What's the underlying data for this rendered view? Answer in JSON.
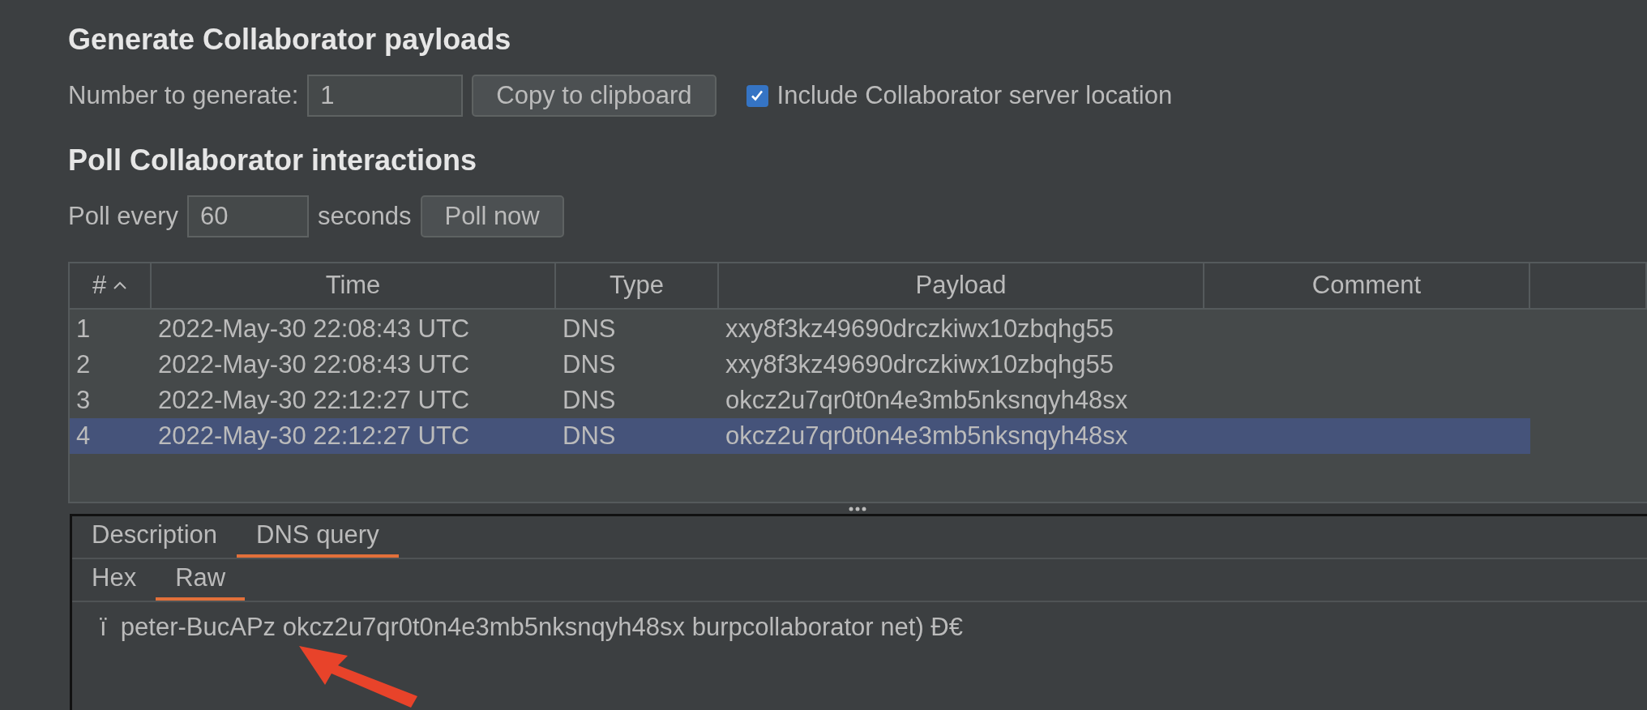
{
  "generate": {
    "heading": "Generate Collaborator payloads",
    "number_label": "Number to generate:",
    "number_value": "1",
    "copy_button": "Copy to clipboard",
    "include_location": {
      "label": "Include Collaborator server location",
      "checked": true
    }
  },
  "poll": {
    "heading": "Poll Collaborator interactions",
    "label_before": "Poll every",
    "interval_value": "60",
    "label_after": "seconds",
    "poll_button": "Poll now"
  },
  "table": {
    "columns": [
      {
        "label": "#",
        "sorted": true
      },
      {
        "label": "Time",
        "sorted": false
      },
      {
        "label": "Type",
        "sorted": false
      },
      {
        "label": "Payload",
        "sorted": false
      },
      {
        "label": "Comment",
        "sorted": false
      }
    ],
    "rows": [
      {
        "cells": [
          "1",
          "2022-May-30 22:08:43 UTC",
          "DNS",
          "xxy8f3kz49690drczkiwx10zbqhg55"
        ],
        "selected": false
      },
      {
        "cells": [
          "2",
          "2022-May-30 22:08:43 UTC",
          "DNS",
          "xxy8f3kz49690drczkiwx10zbqhg55"
        ],
        "selected": false
      },
      {
        "cells": [
          "3",
          "2022-May-30 22:12:27 UTC",
          "DNS",
          "okcz2u7qr0t0n4e3mb5nksnqyh48sx"
        ],
        "selected": false
      },
      {
        "cells": [
          "4",
          "2022-May-30 22:12:27 UTC",
          "DNS",
          "okcz2u7qr0t0n4e3mb5nksnqyh48sx"
        ],
        "selected": true
      }
    ]
  },
  "detail": {
    "tabs": [
      {
        "label": "Description",
        "selected": false
      },
      {
        "label": "DNS query",
        "selected": true
      }
    ],
    "subtabs": [
      {
        "label": "Hex",
        "selected": false
      },
      {
        "label": "Raw",
        "selected": true
      }
    ],
    "raw_text": "ï  peter-BucAPz okcz2u7qr0t0n4e3mb5nksnqyh48sx burpcollaborator net) Ð€"
  }
}
